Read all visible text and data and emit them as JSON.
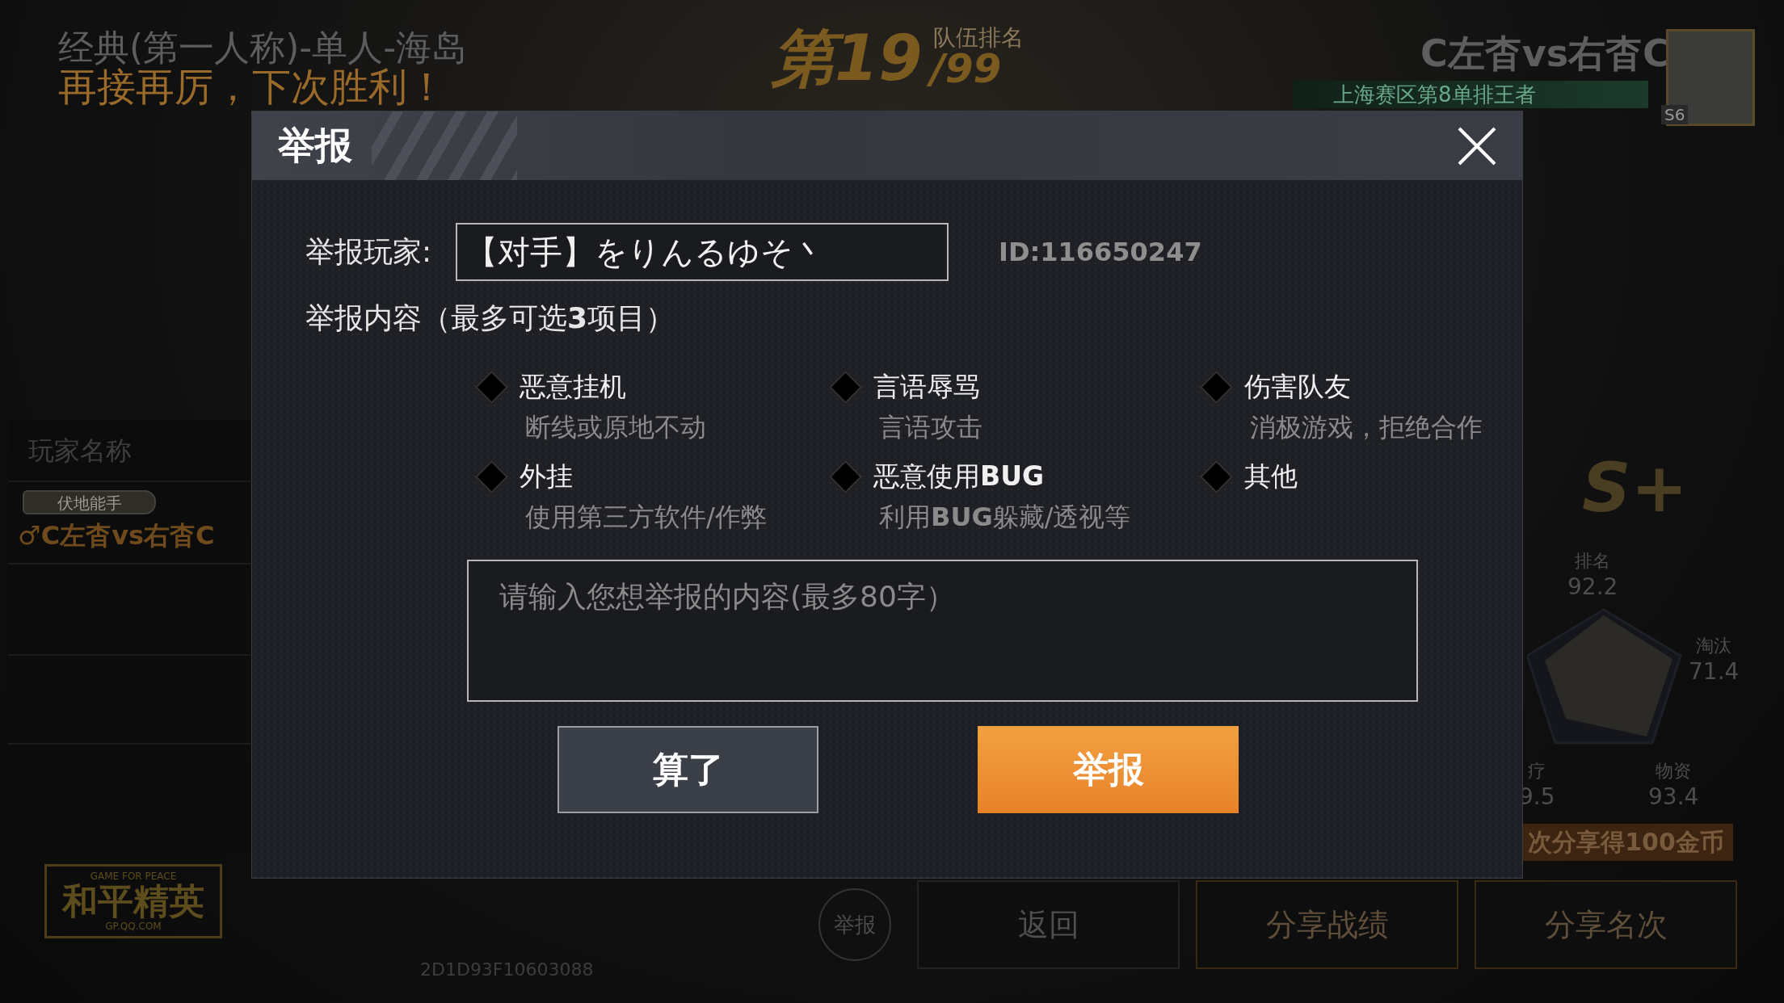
{
  "background": {
    "mode_title": "经典(第一人称)-单人-海岛",
    "result_message": "再接再厉，下次胜利！",
    "rank": "第19",
    "rank_total": "/99",
    "rank_label": "队伍排名",
    "player_name": "C左杳vs右杳C",
    "player_title": "上海赛区第8单排王者",
    "season_badge": "S6",
    "column_header": "玩家名称",
    "player_tag": "伏地能手",
    "player_entry": "♂C左杳vs右杳C",
    "grade": "S+",
    "stats": [
      {
        "label": "排名",
        "value": "92.2"
      },
      {
        "label": "淘汰",
        "value": "71.4"
      },
      {
        "label": "疗",
        "value": "9.5"
      },
      {
        "label": "物资",
        "value": "93.4"
      }
    ],
    "share_hint": "次分享得100金币",
    "logo": {
      "top": "GAME FOR PEACE",
      "name": "和平精英",
      "bottom": "GP.QQ.COM"
    },
    "report_button": "举报",
    "buttons": [
      "返回",
      "分享战绩",
      "分享名次"
    ],
    "code": "2D1D93F10603088"
  },
  "dialog": {
    "title": "举报",
    "player_label": "举报玩家:",
    "player_value": "【对手】をりんるゆそ丶",
    "player_id": "ID:116650247",
    "content_label": "举报内容（最多可选**3**项目）",
    "options": [
      {
        "name": "恶意挂机",
        "description": "断线或原地不动",
        "checked": false
      },
      {
        "name": "言语辱骂",
        "description": "言语攻击",
        "checked": false
      },
      {
        "name": "伤害队友",
        "description": "消极游戏，拒绝合作",
        "checked": false
      },
      {
        "name": "外挂",
        "description": "使用第三方软件/作弊",
        "checked": false
      },
      {
        "name": "恶意使用**BUG**",
        "description": "利用**BUG**躲藏/透视等",
        "checked": false
      },
      {
        "name": "其他",
        "checked": false
      }
    ],
    "comment": {
      "placeholder": "请输入您想举报的内容(最多80字）"
    },
    "cancel_button": "算了",
    "submit_button": "举报"
  }
}
